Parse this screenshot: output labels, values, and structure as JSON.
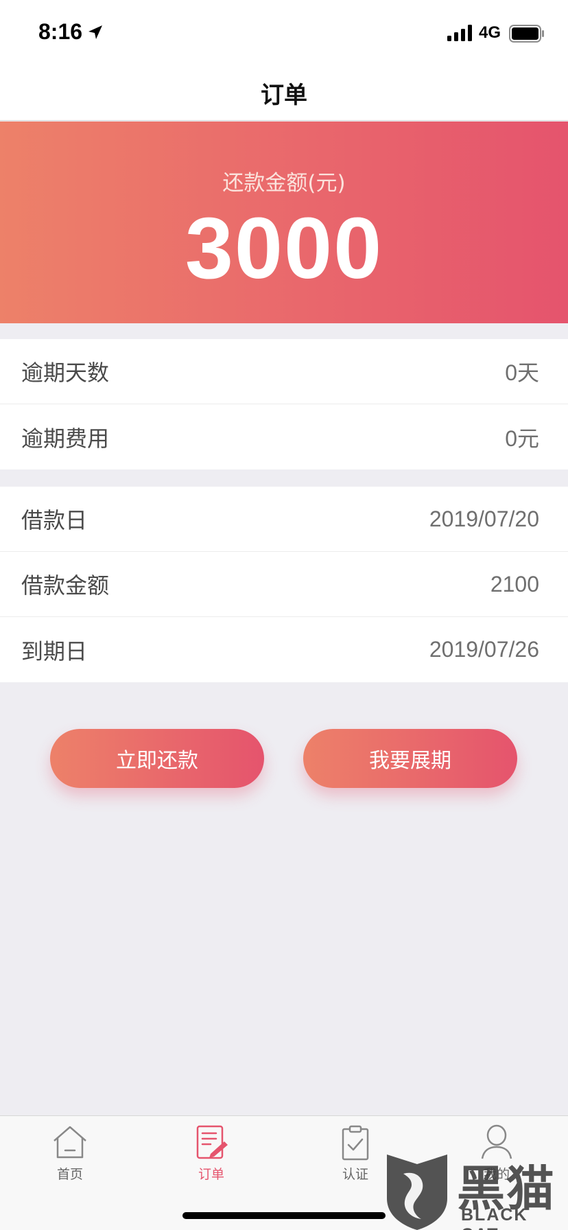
{
  "status_bar": {
    "time": "8:16",
    "network": "4G",
    "icons": [
      "location-arrow-icon",
      "signal-bars-icon",
      "battery-icon"
    ]
  },
  "nav": {
    "title": "订单"
  },
  "hero": {
    "label": "还款金额(元)",
    "amount": "3000"
  },
  "overdue": [
    {
      "label": "逾期天数",
      "value": "0天"
    },
    {
      "label": "逾期费用",
      "value": "0元"
    }
  ],
  "loan": [
    {
      "label": "借款日",
      "value": "2019/07/20"
    },
    {
      "label": "借款金额",
      "value": "2100"
    },
    {
      "label": "到期日",
      "value": "2019/07/26"
    }
  ],
  "actions": {
    "repay": "立即还款",
    "extend": "我要展期"
  },
  "tabs": [
    {
      "label": "首页",
      "icon": "home-icon",
      "active": false
    },
    {
      "label": "订单",
      "icon": "order-icon",
      "active": true
    },
    {
      "label": "认证",
      "icon": "clipboard-check-icon",
      "active": false
    },
    {
      "label": "我的",
      "icon": "user-icon",
      "active": false
    }
  ],
  "watermark": {
    "cn": "黑猫",
    "en": "BLACK CAT"
  },
  "colors": {
    "accent": "#e5546d",
    "gradient_start": "#ed8169",
    "gradient_end": "#e5546d",
    "background": "#eeedf2"
  }
}
